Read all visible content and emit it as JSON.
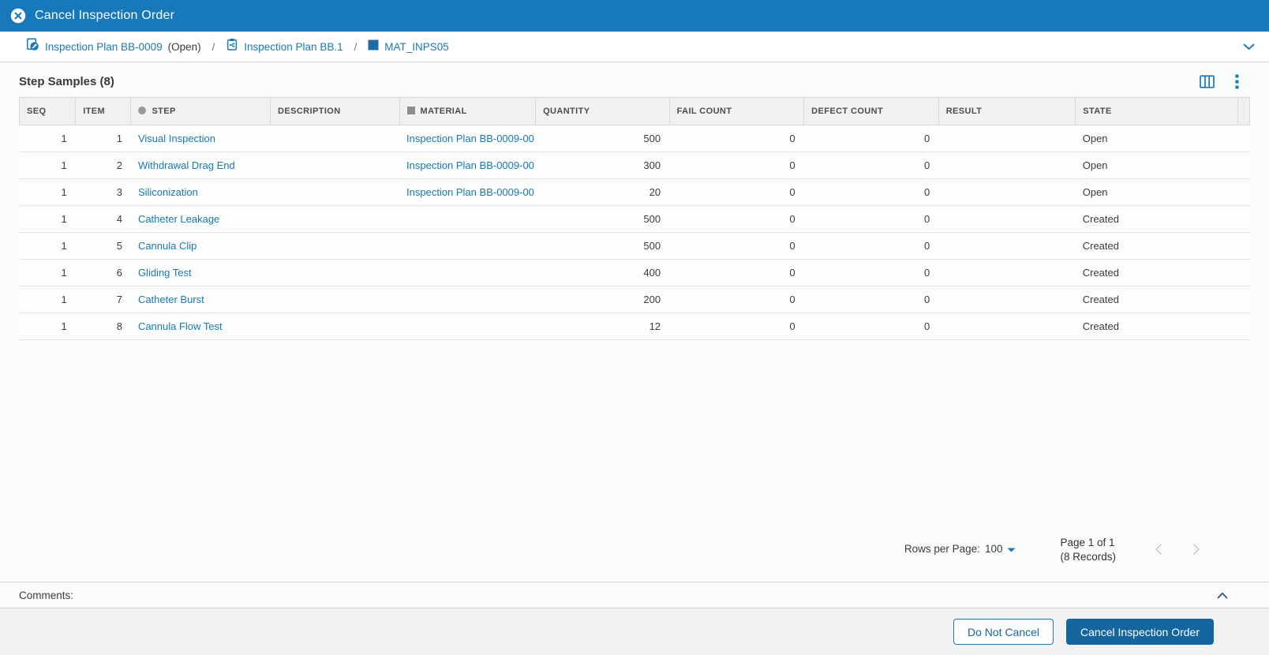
{
  "window": {
    "title": "Cancel Inspection Order"
  },
  "breadcrumb": {
    "separator": "/",
    "items": [
      {
        "label": "Inspection Plan BB-0009",
        "status": "(Open)",
        "icon": "inspection-plan-wrench-icon"
      },
      {
        "label": "Inspection Plan BB.1",
        "status": "",
        "icon": "inspection-plan-clipboard-icon"
      },
      {
        "label": "MAT_INPS05",
        "status": "",
        "icon": "material-swatch-icon"
      }
    ]
  },
  "grid": {
    "title": "Step Samples (8)",
    "columns": {
      "seq": "SEQ",
      "item": "ITEM",
      "step": "STEP",
      "description": "DESCRIPTION",
      "material": "MATERIAL",
      "quantity": "QUANTITY",
      "fail": "FAIL COUNT",
      "defect": "DEFECT COUNT",
      "result": "RESULT",
      "state": "STATE"
    },
    "rows": [
      {
        "seq": "1",
        "item": "1",
        "step": "Visual Inspection",
        "description": "",
        "material": "Inspection Plan BB-0009-00",
        "quantity": "500",
        "fail": "0",
        "defect": "0",
        "result": "",
        "state": "Open"
      },
      {
        "seq": "1",
        "item": "2",
        "step": "Withdrawal Drag End",
        "description": "",
        "material": "Inspection Plan BB-0009-00",
        "quantity": "300",
        "fail": "0",
        "defect": "0",
        "result": "",
        "state": "Open"
      },
      {
        "seq": "1",
        "item": "3",
        "step": "Siliconization",
        "description": "",
        "material": "Inspection Plan BB-0009-00",
        "quantity": "20",
        "fail": "0",
        "defect": "0",
        "result": "",
        "state": "Open"
      },
      {
        "seq": "1",
        "item": "4",
        "step": "Catheter Leakage",
        "description": "",
        "material": "",
        "quantity": "500",
        "fail": "0",
        "defect": "0",
        "result": "",
        "state": "Created"
      },
      {
        "seq": "1",
        "item": "5",
        "step": "Cannula Clip",
        "description": "",
        "material": "",
        "quantity": "500",
        "fail": "0",
        "defect": "0",
        "result": "",
        "state": "Created"
      },
      {
        "seq": "1",
        "item": "6",
        "step": "Gliding Test",
        "description": "",
        "material": "",
        "quantity": "400",
        "fail": "0",
        "defect": "0",
        "result": "",
        "state": "Created"
      },
      {
        "seq": "1",
        "item": "7",
        "step": "Catheter Burst",
        "description": "",
        "material": "",
        "quantity": "200",
        "fail": "0",
        "defect": "0",
        "result": "",
        "state": "Created"
      },
      {
        "seq": "1",
        "item": "8",
        "step": "Cannula Flow Test",
        "description": "",
        "material": "",
        "quantity": "12",
        "fail": "0",
        "defect": "0",
        "result": "",
        "state": "Created"
      }
    ],
    "pagination": {
      "rows_per_page_label": "Rows per Page:",
      "rows_per_page_value": "100",
      "page_label": "Page 1 of 1",
      "records_label": "(8 Records)"
    }
  },
  "comments": {
    "label": "Comments:"
  },
  "actions": {
    "do_not_cancel": "Do Not Cancel",
    "cancel_order": "Cancel Inspection Order"
  },
  "colors": {
    "primary_blue": "#1779ba",
    "button_blue": "#15669f",
    "link_blue": "#1779ba",
    "header_gray": "#f0f1f1",
    "page_bg": "#fafbfb",
    "footer_bg": "#f2f2f2"
  }
}
